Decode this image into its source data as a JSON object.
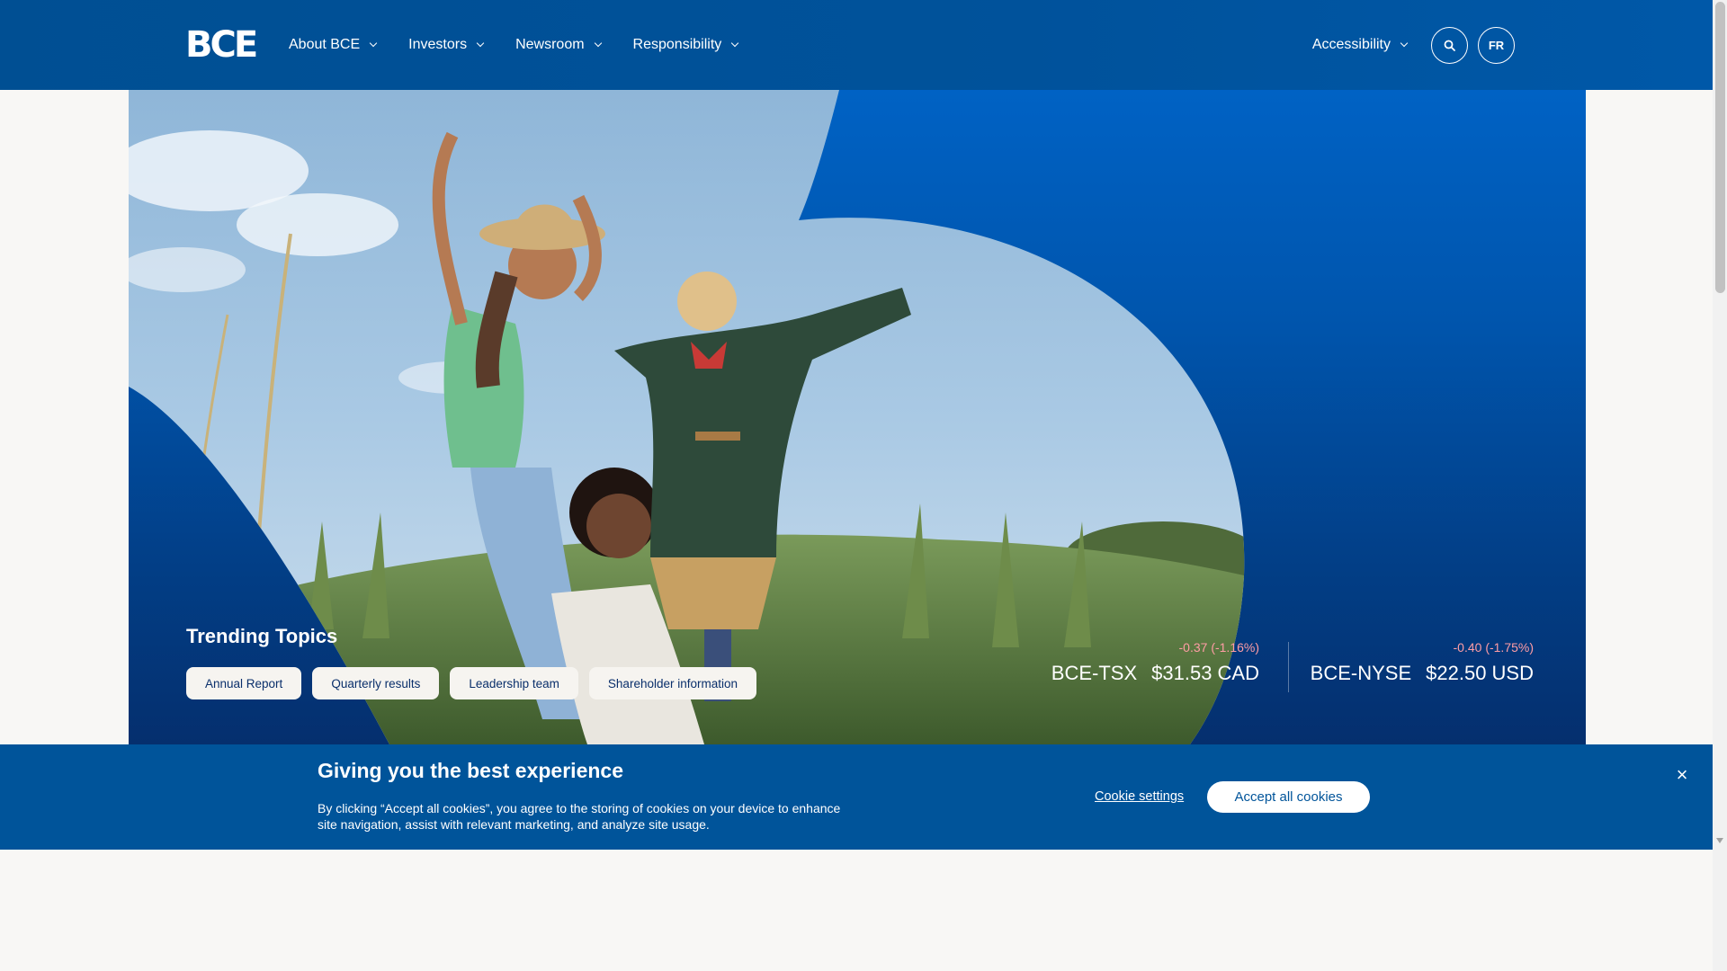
{
  "header": {
    "logo": "BCE",
    "nav": [
      {
        "label": "About BCE"
      },
      {
        "label": "Investors"
      },
      {
        "label": "Newsroom"
      },
      {
        "label": "Responsibility"
      }
    ],
    "accessibility_label": "Accessibility",
    "language_label": "FR",
    "search_icon": "search-icon"
  },
  "hero": {
    "trending_title": "Trending Topics",
    "chips": [
      "Annual Report",
      "Quarterly results",
      "Leadership team",
      "Shareholder information"
    ],
    "stocks": [
      {
        "change": "-0.37 (-1.16%)",
        "ticker": "BCE-TSX",
        "price": "$31.53 CAD"
      },
      {
        "change": "-0.40 (-1.75%)",
        "ticker": "BCE-NYSE",
        "price": "$22.50 USD"
      }
    ]
  },
  "cookie": {
    "title": "Giving you the best experience",
    "text": "By clicking “Accept all cookies”, you agree to the storing of cookies on your device to enhance site navigation, assist with relevant marketing, and analyze site usage.",
    "settings_label": "Cookie settings",
    "accept_label": "Accept all cookies",
    "close_label": "×"
  },
  "colors": {
    "brand_blue": "#00549a",
    "negative": "#ff9da5",
    "chip_bg": "#f6f4f0"
  }
}
